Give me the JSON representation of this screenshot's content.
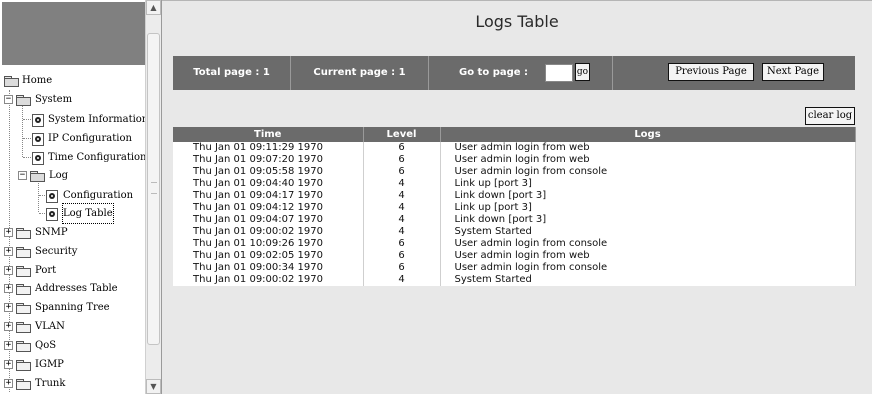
{
  "sidebar": {
    "tree": [
      {
        "label": "Home"
      },
      {
        "label": "System"
      },
      {
        "label": "System Information"
      },
      {
        "label": "IP Configuration"
      },
      {
        "label": "Time Configuration"
      },
      {
        "label": "Log"
      },
      {
        "label": "Configuration"
      },
      {
        "label": "Log Table"
      },
      {
        "label": "SNMP"
      },
      {
        "label": "Security"
      },
      {
        "label": "Port"
      },
      {
        "label": "Addresses Table"
      },
      {
        "label": "Spanning Tree"
      },
      {
        "label": "VLAN"
      },
      {
        "label": "QoS"
      },
      {
        "label": "IGMP"
      },
      {
        "label": "Trunk"
      }
    ],
    "expand_glyph": "+",
    "collapse_glyph": "−"
  },
  "main": {
    "title": "Logs Table",
    "nav": {
      "total_page": "Total page : 1",
      "current_page": "Current page : 1",
      "goto_label": "Go to page :",
      "goto_value": "",
      "go_label": "go",
      "prev_label": "Previous Page",
      "next_label": "Next Page"
    },
    "clear_label": "clear log",
    "table": {
      "headers": [
        "Time",
        "Level",
        "Logs"
      ],
      "rows": [
        [
          "Thu Jan 01 09:11:29 1970",
          "6",
          "User admin login from web"
        ],
        [
          "Thu Jan 01 09:07:20 1970",
          "6",
          "User admin login from web"
        ],
        [
          "Thu Jan 01 09:05:58 1970",
          "6",
          "User admin login from console"
        ],
        [
          "Thu Jan 01 09:04:40 1970",
          "4",
          "Link up [port 3]"
        ],
        [
          "Thu Jan 01 09:04:17 1970",
          "4",
          "Link down [port 3]"
        ],
        [
          "Thu Jan 01 09:04:12 1970",
          "4",
          "Link up [port 3]"
        ],
        [
          "Thu Jan 01 09:04:07 1970",
          "4",
          "Link down [port 3]"
        ],
        [
          "Thu Jan 01 09:00:02 1970",
          "4",
          "System Started"
        ],
        [
          "Thu Jan 01 10:09:26 1970",
          "6",
          "User admin login from console"
        ],
        [
          "Thu Jan 01 09:02:05 1970",
          "6",
          "User admin login from web"
        ],
        [
          "Thu Jan 01 09:00:34 1970",
          "6",
          "User admin login from console"
        ],
        [
          "Thu Jan 01 09:00:02 1970",
          "4",
          "System Started"
        ]
      ]
    }
  },
  "colors": {
    "header_gray": "#6b6b6b",
    "content_bg": "#e8e8e8",
    "logo_gray": "#808080"
  }
}
